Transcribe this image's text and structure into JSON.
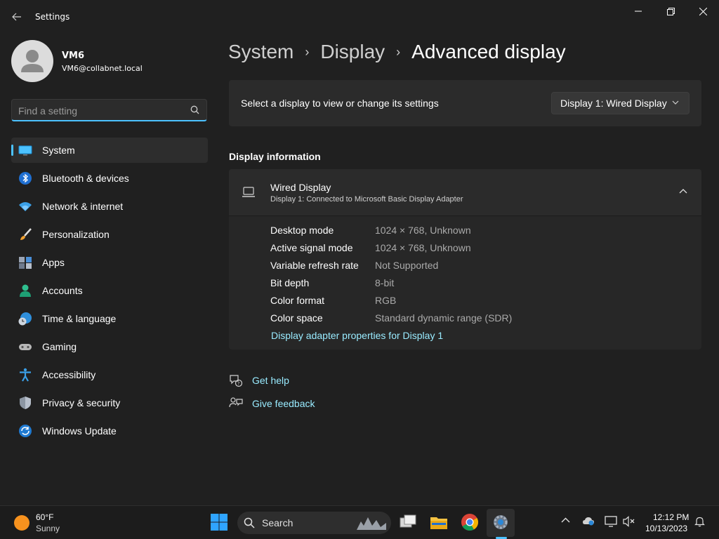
{
  "window": {
    "title": "Settings"
  },
  "profile": {
    "name": "VM6",
    "email": "VM6@collabnet.local"
  },
  "search": {
    "placeholder": "Find a setting",
    "value": ""
  },
  "nav": {
    "items": [
      {
        "label": "System",
        "icon": "monitor-icon",
        "active": true
      },
      {
        "label": "Bluetooth & devices",
        "icon": "bluetooth-icon"
      },
      {
        "label": "Network & internet",
        "icon": "wifi-icon"
      },
      {
        "label": "Personalization",
        "icon": "brush-icon"
      },
      {
        "label": "Apps",
        "icon": "apps-icon"
      },
      {
        "label": "Accounts",
        "icon": "person-icon"
      },
      {
        "label": "Time & language",
        "icon": "clock-globe-icon"
      },
      {
        "label": "Gaming",
        "icon": "gamepad-icon"
      },
      {
        "label": "Accessibility",
        "icon": "accessibility-icon"
      },
      {
        "label": "Privacy & security",
        "icon": "shield-icon"
      },
      {
        "label": "Windows Update",
        "icon": "update-icon"
      }
    ]
  },
  "breadcrumb": {
    "items": [
      "System",
      "Display"
    ],
    "separator": "›",
    "current": "Advanced display"
  },
  "display_select": {
    "label": "Select a display to view or change its settings",
    "selected": "Display 1: Wired Display"
  },
  "display_info": {
    "section_title": "Display information",
    "display_name": "Wired Display",
    "display_subtitle": "Display 1: Connected to Microsoft Basic Display Adapter",
    "rows": [
      {
        "key": "Desktop mode",
        "value": "1024 × 768, Unknown"
      },
      {
        "key": "Active signal mode",
        "value": "1024 × 768, Unknown"
      },
      {
        "key": "Variable refresh rate",
        "value": "Not Supported"
      },
      {
        "key": "Bit depth",
        "value": "8-bit"
      },
      {
        "key": "Color format",
        "value": "RGB"
      },
      {
        "key": "Color space",
        "value": "Standard dynamic range (SDR)"
      }
    ],
    "adapter_link": "Display adapter properties for Display 1"
  },
  "help": {
    "get_help": "Get help",
    "give_feedback": "Give feedback"
  },
  "taskbar": {
    "weather_temp": "60°F",
    "weather_condition": "Sunny",
    "search_label": "Search",
    "clock_time": "12:12 PM",
    "clock_date": "10/13/2023"
  },
  "colors": {
    "accent": "#4cc2ff",
    "link": "#99ebff",
    "background": "#202020",
    "card": "#2b2b2b"
  }
}
